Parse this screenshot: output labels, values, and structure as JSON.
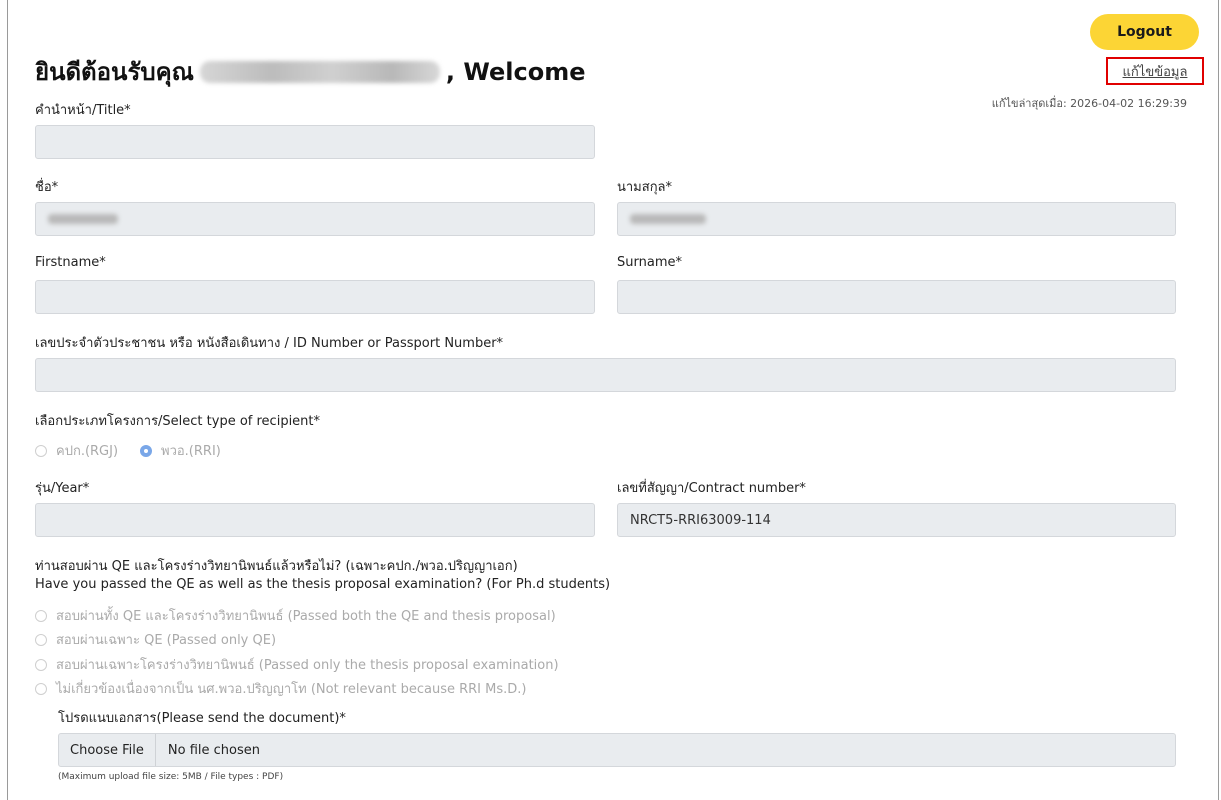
{
  "header": {
    "logout_label": "Logout",
    "welcome_prefix": "ยินดีต้อนรับคุณ",
    "welcome_suffix": ", Welcome",
    "edit_link": "แก้ไขข้อมูล",
    "last_edited": "แก้ไขล่าสุดเมื่อ: 2026-04-02 16:29:39"
  },
  "form": {
    "title_label": "คำนำหน้า/Title*",
    "title_value": "",
    "thai_firstname_label": "ชื่อ*",
    "thai_surname_label": "นามสกุล*",
    "firstname_label": "Firstname*",
    "firstname_value": "",
    "surname_label": "Surname*",
    "surname_value": "",
    "id_label": "เลขประจำตัวประชาชน หรือ หนังสือเดินทาง / ID Number or Passport Number*",
    "id_value": "",
    "recipient_label": "เลือกประเภทโครงการ/Select type of recipient*",
    "recipient_options": [
      {
        "label": "คปก.(RGJ)",
        "checked": false
      },
      {
        "label": "พวอ.(RRI)",
        "checked": true
      }
    ],
    "year_label": "รุ่น/Year*",
    "year_value": "",
    "contract_label": "เลขที่สัญญา/Contract number*",
    "contract_value": "NRCT5-RRI63009-114",
    "qe_question_th": "ท่านสอบผ่าน QE และโครงร่างวิทยานิพนธ์แล้วหรือไม่? (เฉพาะคปก./พวอ.ปริญญาเอก)",
    "qe_question_en": "Have you passed the QE as well as the thesis proposal examination? (For Ph.d students)",
    "qe_options": [
      "สอบผ่านทั้ง QE และโครงร่างวิทยานิพนธ์ (Passed both the QE and thesis proposal)",
      "สอบผ่านเฉพาะ QE (Passed only QE)",
      "สอบผ่านเฉพาะโครงร่างวิทยานิพนธ์ (Passed only the thesis proposal examination)",
      "ไม่เกี่ยวข้องเนื่องจากเป็น นศ.พวอ.ปริญญาโท (Not relevant because RRI Ms.D.)"
    ],
    "document_label": "โปรดแนบเอกสาร(Please send the document)*",
    "choose_file_label": "Choose File",
    "file_status": "No file chosen",
    "upload_hint": "(Maximum upload file size: 5MB / File types : PDF)"
  }
}
